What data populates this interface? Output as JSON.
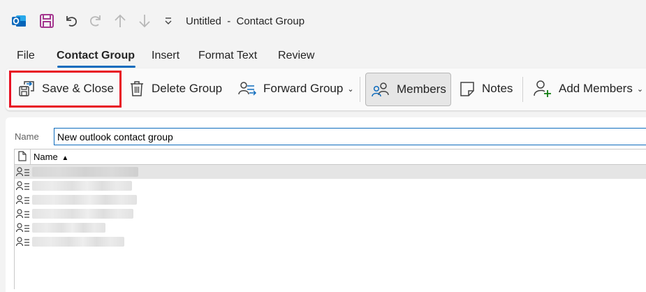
{
  "titlebar": {
    "title": "Untitled  -  Contact Group",
    "icons": [
      "outlook-icon",
      "save-icon",
      "undo-icon",
      "redo-icon",
      "up-arrow-icon",
      "down-arrow-icon",
      "customize-qat-icon"
    ]
  },
  "menu": {
    "tabs": [
      {
        "label": "File"
      },
      {
        "label": "Contact Group",
        "active": true
      },
      {
        "label": "Insert"
      },
      {
        "label": "Format Text"
      },
      {
        "label": "Review"
      }
    ]
  },
  "ribbon": {
    "save_close": "Save & Close",
    "delete_group": "Delete Group",
    "forward_group": "Forward Group",
    "members": "Members",
    "notes": "Notes",
    "add_members": "Add Members"
  },
  "form": {
    "name_label": "Name",
    "name_value": "New outlook contact group"
  },
  "list": {
    "header_name": "Name",
    "sort": "ascending",
    "rows": [
      {
        "selected": true
      },
      {
        "selected": false
      },
      {
        "selected": false
      },
      {
        "selected": false
      },
      {
        "selected": false
      },
      {
        "selected": false
      }
    ]
  },
  "colors": {
    "accent": "#0f6cbd",
    "highlight_box": "#e81123",
    "outlook_brand": "#0f6cbd",
    "save_icon": "#a4378f"
  }
}
